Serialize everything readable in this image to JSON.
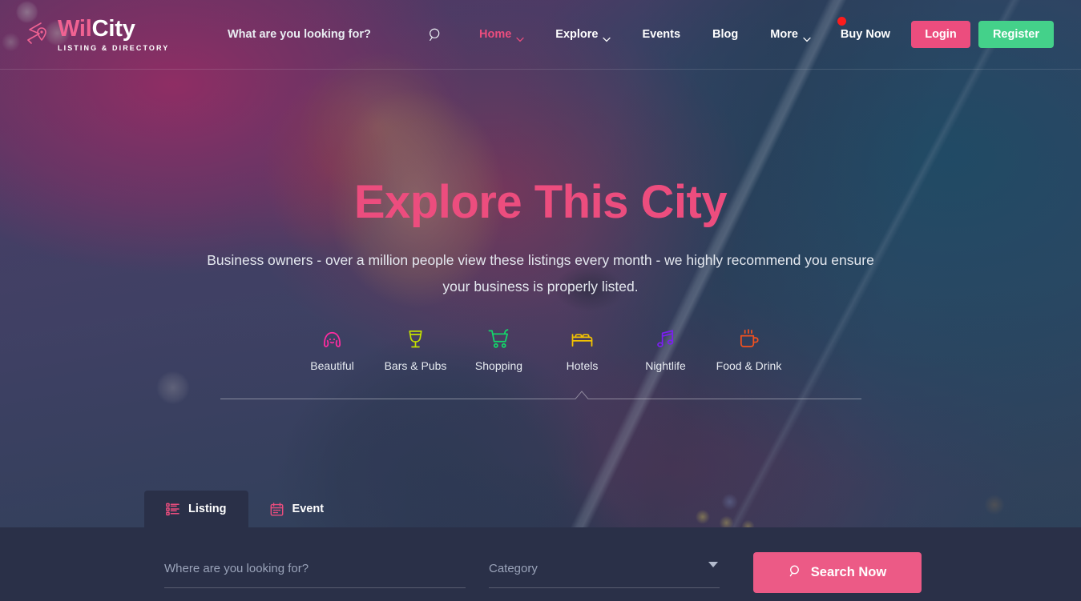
{
  "brand": {
    "logo_icon": "route-pin-logo-icon",
    "name_part1": "Wil",
    "name_part2": "City",
    "tagline": "LISTING & DIRECTORY",
    "accent_pink": "#ec4d7e",
    "accent_green": "#44d18a",
    "panel_dark": "#2a3048"
  },
  "header": {
    "search_label": "What are you looking for?",
    "search_icon": "search-icon",
    "nav": [
      {
        "label": "Home",
        "has_caret": true,
        "active": true
      },
      {
        "label": "Explore",
        "has_caret": true,
        "active": false
      },
      {
        "label": "Events",
        "has_caret": false,
        "active": false
      },
      {
        "label": "Blog",
        "has_caret": false,
        "active": false
      },
      {
        "label": "More",
        "has_caret": true,
        "active": false
      }
    ],
    "buy_now": "Buy Now",
    "buy_now_badge_color": "#fb1c1c",
    "login": "Login",
    "register": "Register"
  },
  "hero": {
    "title": "Explore This City",
    "subtitle": "Business owners - over a million people view these listings every month - we highly recommend you ensure your business is properly listed.",
    "categories": [
      {
        "label": "Beautiful",
        "icon": "beauty-salon-icon",
        "color": "#ff2ba0"
      },
      {
        "label": "Bars & Pubs",
        "icon": "wine-glass-icon",
        "color": "#c3e000"
      },
      {
        "label": "Shopping",
        "icon": "shopping-cart-icon",
        "color": "#12d96a"
      },
      {
        "label": "Hotels",
        "icon": "hotel-bed-icon",
        "color": "#f5c400"
      },
      {
        "label": "Nightlife",
        "icon": "music-note-icon",
        "color": "#7b1ff0"
      },
      {
        "label": "Food & Drink",
        "icon": "coffee-cup-icon",
        "color": "#f4511e"
      }
    ],
    "active_category_index": 3
  },
  "tabs": [
    {
      "label": "Listing",
      "icon": "list-icon",
      "active": true
    },
    {
      "label": "Event",
      "icon": "calendar-icon",
      "active": false
    }
  ],
  "search_panel": {
    "where_placeholder": "Where are you looking for?",
    "where_value": "",
    "category_value": "Category",
    "category_icon": "chevron-down-icon",
    "search_button_label": "Search Now",
    "search_button_icon": "search-icon"
  }
}
